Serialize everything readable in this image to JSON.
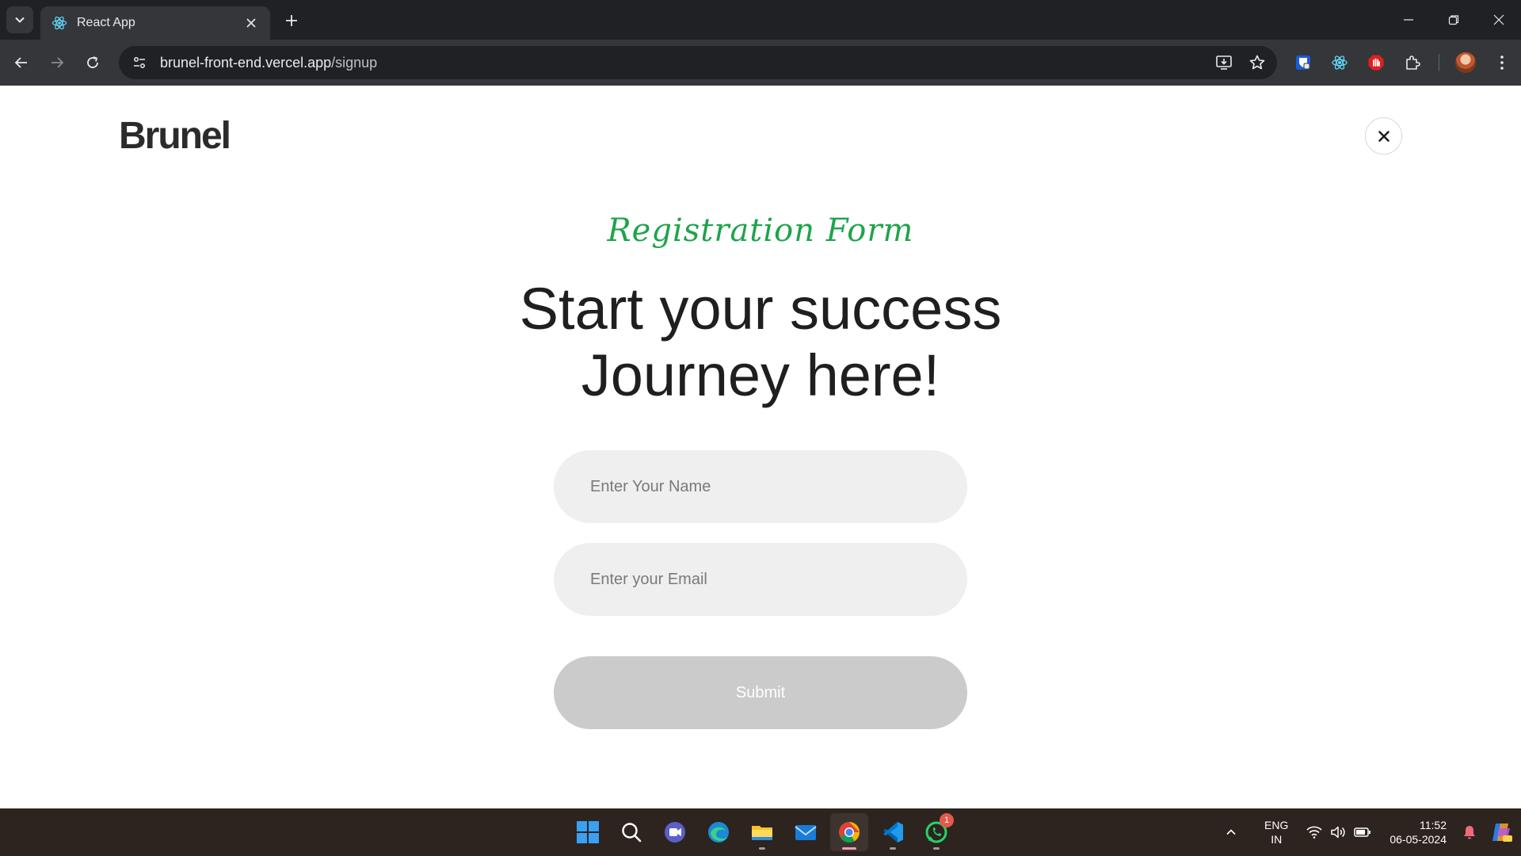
{
  "browser": {
    "tab": {
      "title": "React App"
    },
    "url": {
      "domain": "brunel-front-end.vercel.app",
      "path": "/signup"
    }
  },
  "page": {
    "logo": "Brunel",
    "form_tag": "Registration Form",
    "headline_line1": "Start your success",
    "headline_line2": "Journey here!",
    "name_input": {
      "placeholder": "Enter Your Name",
      "value": ""
    },
    "email_input": {
      "placeholder": "Enter your Email",
      "value": ""
    },
    "submit_label": "Submit"
  },
  "taskbar": {
    "apps": [
      "start-icon",
      "search-icon",
      "meet-icon",
      "edge-icon",
      "file-explorer-icon",
      "mail-icon",
      "chrome-icon",
      "vscode-icon",
      "whatsapp-icon"
    ],
    "whatsapp_badge": "1",
    "lang_top": "ENG",
    "lang_bottom": "IN",
    "time": "11:52",
    "date": "06-05-2024"
  },
  "colors": {
    "accent_green": "#1ea44b",
    "submit_disabled": "#cbcbcb",
    "input_bg": "#efefef"
  }
}
